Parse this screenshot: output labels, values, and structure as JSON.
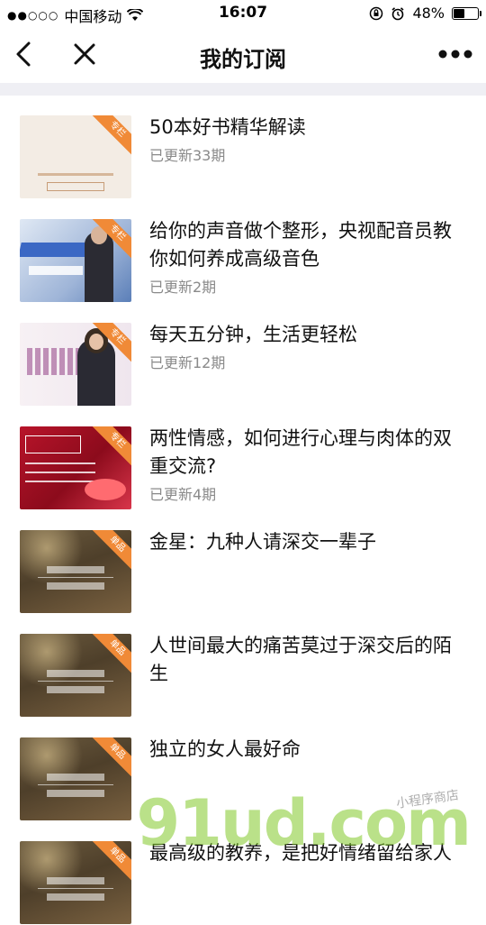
{
  "status_bar": {
    "carrier": "中国移动",
    "time": "16:07",
    "battery": "48%",
    "battery_fraction": 0.48
  },
  "nav": {
    "title": "我的订阅"
  },
  "items": [
    {
      "title": "50本好书精华解读",
      "updated": "已更新33期",
      "badge": "专栏",
      "thumb": "book"
    },
    {
      "title": "给你的声音做个整形，央视配音员教你如何养成高级音色",
      "updated": "已更新2期",
      "badge": "专栏",
      "thumb": "voice"
    },
    {
      "title": "每天五分钟，生活更轻松",
      "updated": "已更新12期",
      "badge": "专栏",
      "thumb": "life"
    },
    {
      "title": "两性情感，如何进行心理与肉体的双重交流?",
      "updated": "已更新4期",
      "badge": "专栏",
      "thumb": "love"
    },
    {
      "title": "金星：九种人请深交一辈子",
      "updated": "",
      "badge": "单品",
      "thumb": "class"
    },
    {
      "title": "人世间最大的痛苦莫过于深交后的陌生",
      "updated": "",
      "badge": "单品",
      "thumb": "class"
    },
    {
      "title": "独立的女人最好命",
      "updated": "",
      "badge": "单品",
      "thumb": "class"
    },
    {
      "title": "最高级的教养，是把好情绪留给家人",
      "updated": "",
      "badge": "单品",
      "thumb": "class"
    }
  ],
  "watermark": {
    "text": "91ud.com",
    "sub": "小程序商店"
  }
}
